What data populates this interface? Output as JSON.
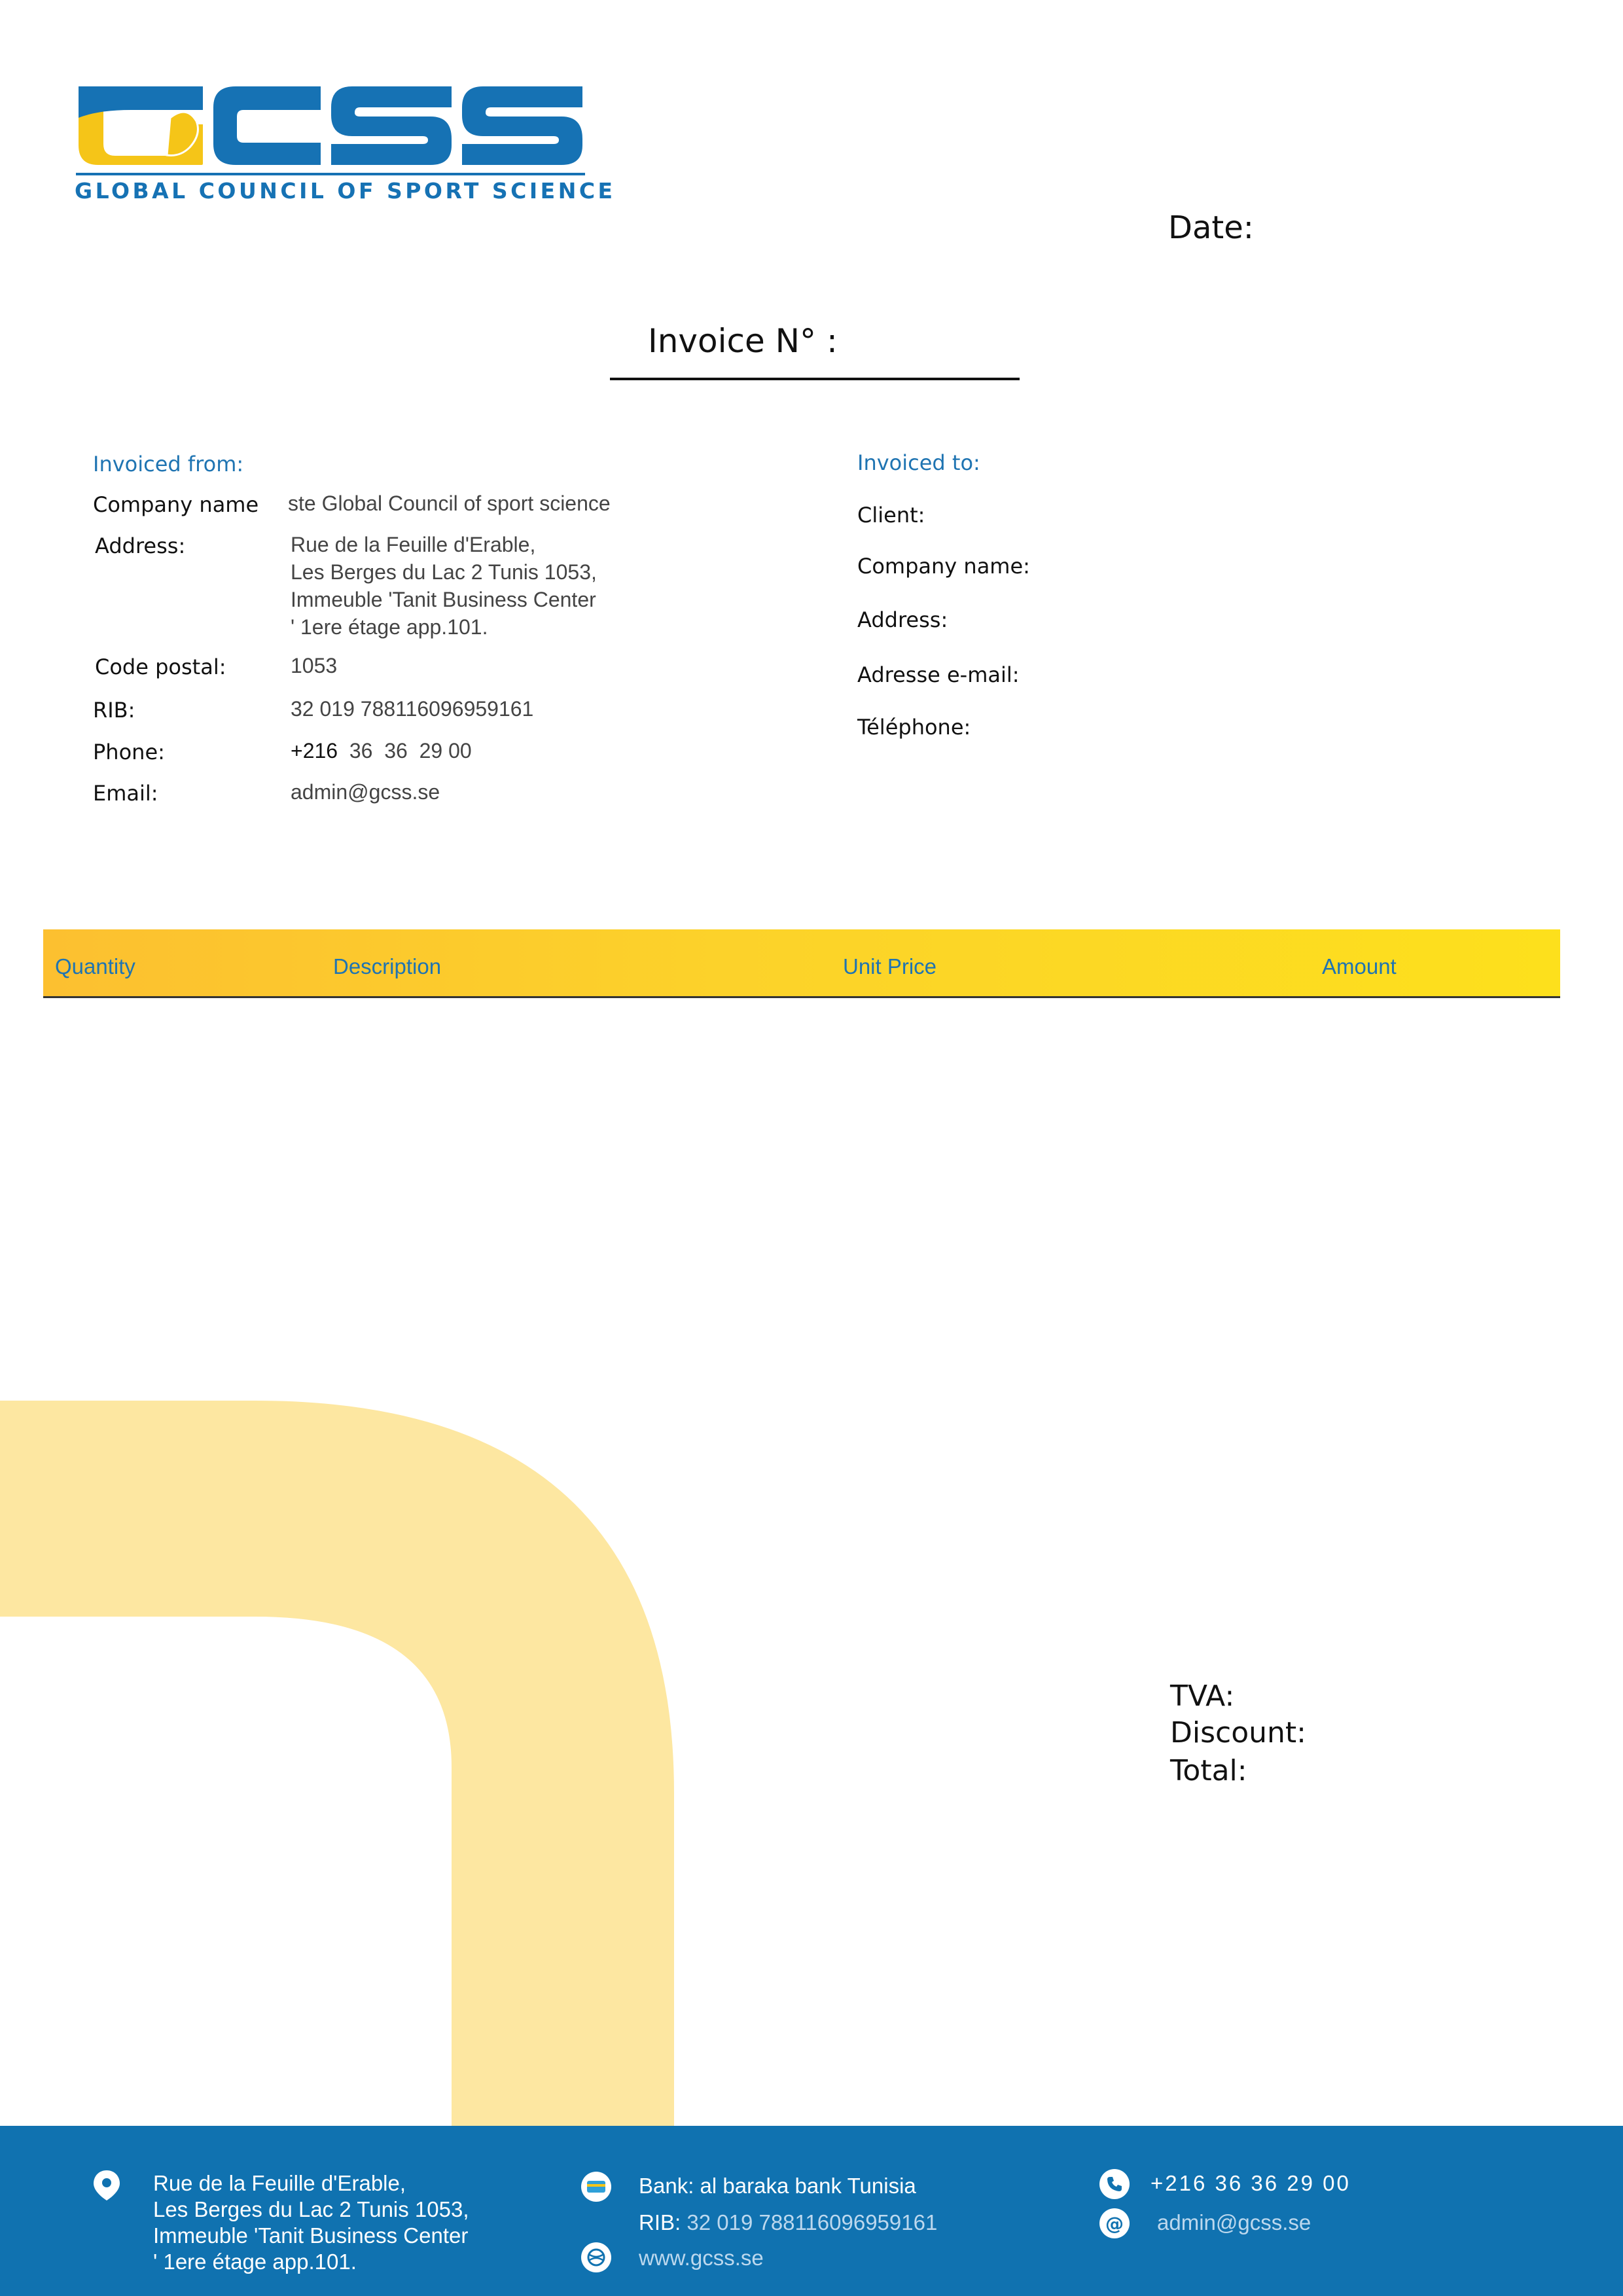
{
  "logo": {
    "wordmark": "GCSS",
    "tagline": "GLOBAL COUNCIL OF SPORT SCIENCE",
    "colors": {
      "blue": "#1672b4",
      "yellow": "#f5c518"
    }
  },
  "date_label": "Date:",
  "invoice_title": "Invoice N° :",
  "from": {
    "heading": "Invoiced from:",
    "company_label": "Company name",
    "company_value": "ste Global Council of sport science",
    "address_label": "Address:",
    "address_lines": [
      "Rue de la Feuille d'Erable,",
      "Les Berges du Lac 2 Tunis 1053,",
      "Immeuble 'Tanit Business Center",
      "' 1ere étage app.101."
    ],
    "postal_label": "Code postal:",
    "postal_value": "1053",
    "rib_label": "RIB:",
    "rib_value": "32 019 788116096959161",
    "phone_label": "Phone:",
    "phone_prefix": "+216",
    "phone_number": "36  36  29 00",
    "email_label": "Email:",
    "email_value": "admin@gcss.se"
  },
  "to": {
    "heading": "Invoiced to:",
    "client_label": "Client:",
    "company_label": "Company name:",
    "address_label": "Address:",
    "email_label": "Adresse e-mail:",
    "phone_label": "Téléphone:"
  },
  "table": {
    "headers": [
      "Quantity",
      "Description",
      "Unit Price",
      "Amount"
    ]
  },
  "totals": {
    "tva_label": "TVA:",
    "discount_label": "Discount:",
    "total_label": "Total:"
  },
  "footer": {
    "address_lines": [
      "Rue de la Feuille d'Erable,",
      "Les Berges du Lac 2 Tunis 1053,",
      "Immeuble 'Tanit Business Center",
      "' 1ere étage app.101."
    ],
    "bank_text": "Bank: al baraka bank Tunisia",
    "rib_label": "RIB:",
    "rib_value": "32 019 788116096959161",
    "website": "www.gcss.se",
    "phone": "+216 36 36 29 00",
    "email": "admin@gcss.se",
    "icons": [
      "location-pin-icon",
      "bank-card-icon",
      "globe-icon",
      "phone-icon",
      "at-sign-icon"
    ]
  }
}
